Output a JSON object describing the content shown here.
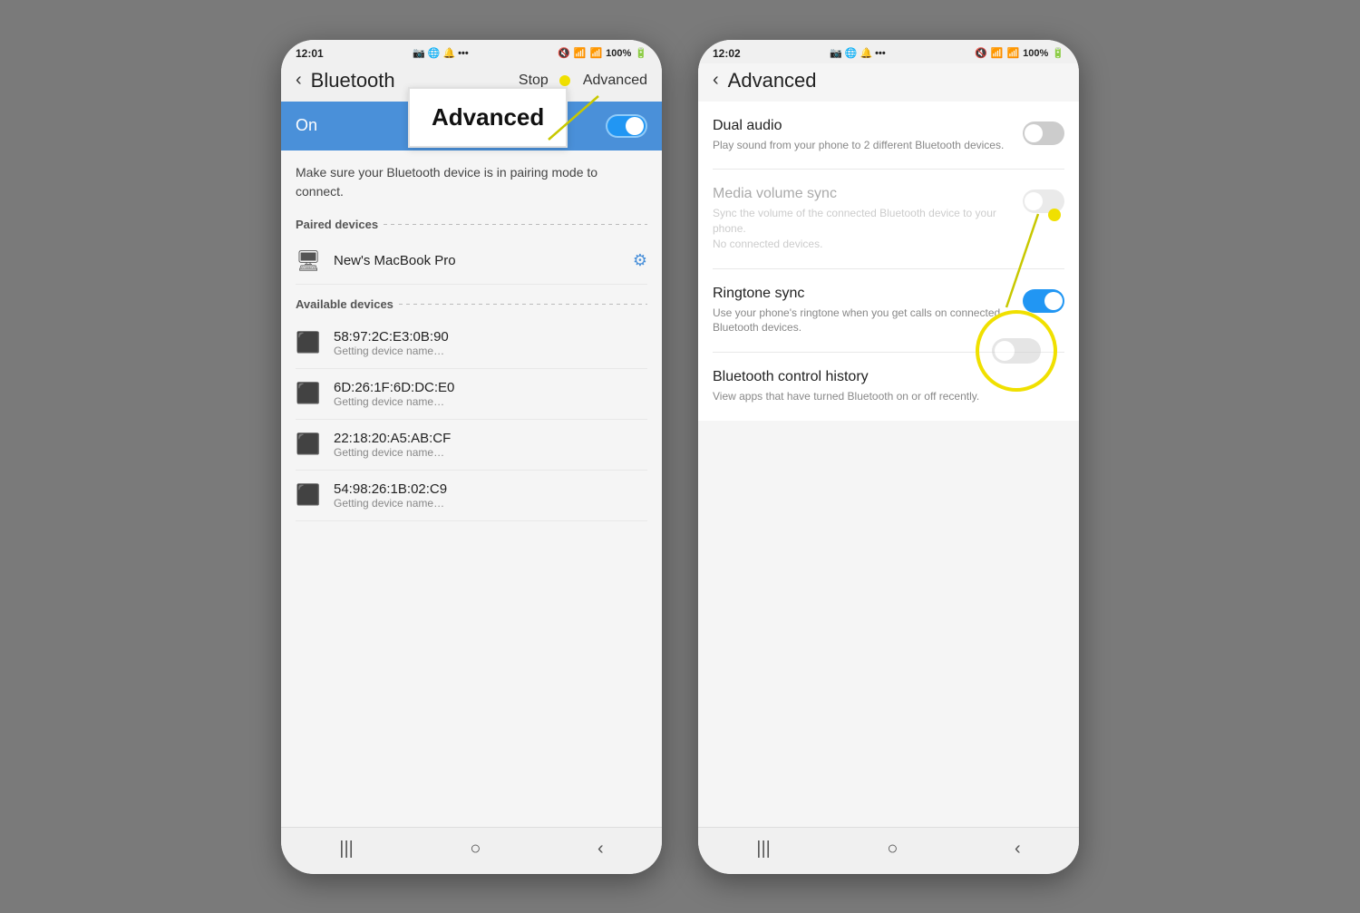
{
  "left_phone": {
    "status_bar": {
      "time": "12:01",
      "icons_left": "📷🌐🔔•••",
      "mute_icon": "🔇",
      "wifi": "WiFi",
      "signal": "📶",
      "battery": "100%",
      "battery_icon": "🔋"
    },
    "app_bar": {
      "back_label": "‹",
      "title": "Bluetooth",
      "stop_label": "Stop",
      "advanced_label": "Advanced"
    },
    "tooltip": {
      "label": "Advanced"
    },
    "bluetooth_header": {
      "on_label": "On"
    },
    "pairing_hint": "Make sure your Bluetooth device is in pairing mode to connect.",
    "paired_devices_header": "Paired devices",
    "paired_devices": [
      {
        "name": "New's MacBook Pro",
        "icon": "💻",
        "has_gear": true
      }
    ],
    "available_devices_header": "Available devices",
    "available_devices": [
      {
        "name": "58:97:2C:E3:0B:90",
        "status": "Getting device name…"
      },
      {
        "name": "6D:26:1F:6D:DC:E0",
        "status": "Getting device name…"
      },
      {
        "name": "22:18:20:A5:AB:CF",
        "status": "Getting device name…"
      },
      {
        "name": "54:98:26:1B:02:C9",
        "status": "Getting device name…"
      }
    ],
    "nav_bar": {
      "recents": "|||",
      "home": "○",
      "back": "‹"
    }
  },
  "right_phone": {
    "status_bar": {
      "time": "12:02",
      "battery": "100%"
    },
    "app_bar": {
      "back_label": "‹",
      "title": "Advanced"
    },
    "settings": [
      {
        "title": "Dual audio",
        "description": "Play sound from your phone to 2 different Bluetooth devices.",
        "toggle_state": "off"
      },
      {
        "title": "Media volume sync",
        "description": "Sync the volume of the connected Bluetooth device to your phone.\nNo connected devices.",
        "toggle_state": "off",
        "dimmed": true
      },
      {
        "title": "Ringtone sync",
        "description": "Use your phone's ringtone when you get calls on connected Bluetooth devices.",
        "toggle_state": "on"
      },
      {
        "title": "Bluetooth control history",
        "description": "View apps that have turned Bluetooth on or off recently.",
        "toggle_state": "none"
      }
    ],
    "nav_bar": {
      "recents": "|||",
      "home": "○",
      "back": "‹"
    }
  }
}
